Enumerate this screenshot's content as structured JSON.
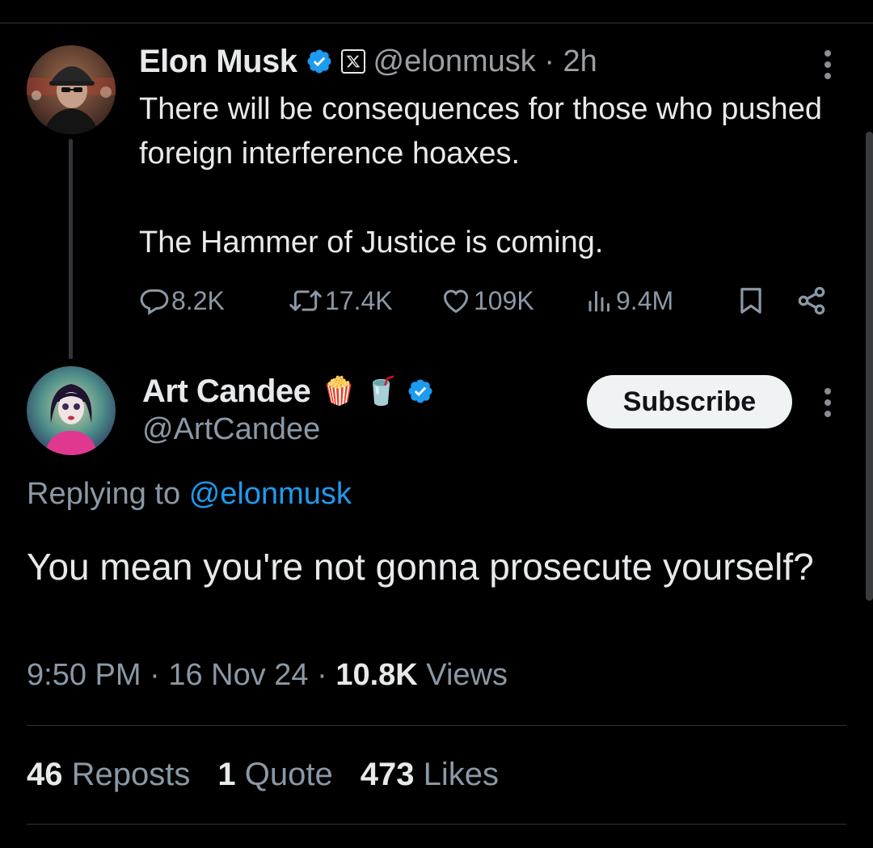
{
  "parent_tweet": {
    "author_name": "Elon Musk",
    "handle": "@elonmusk",
    "separator": "·",
    "time": "2h",
    "text_line1": "There will be consequences for those who pushed foreign interference hoaxes.",
    "text_line2": "The Hammer of Justice is coming.",
    "replies": "8.2K",
    "reposts": "17.4K",
    "likes": "109K",
    "views": "9.4M",
    "icons": [
      "verified-badge-icon",
      "x-affiliate-icon",
      "reply-icon",
      "repost-icon",
      "like-icon",
      "views-icon",
      "bookmark-icon",
      "share-icon",
      "more-icon"
    ]
  },
  "reply_tweet": {
    "author_name": "Art Candee",
    "name_emojis": [
      "🍿",
      "🥤"
    ],
    "handle": "@ArtCandee",
    "subscribe_label": "Subscribe",
    "replying_prefix": "Replying to",
    "replying_to": "@elonmusk",
    "text": "You mean you're not gonna prosecute yourself?",
    "time": "9:50 PM",
    "date": "16 Nov 24",
    "views_count": "10.8K",
    "views_label": "Views",
    "reposts_count": "46",
    "reposts_label": "Reposts",
    "quotes_count": "1",
    "quotes_label": "Quote",
    "likes_count": "473",
    "likes_label": "Likes"
  },
  "colors": {
    "background": "#000000",
    "text": "#e7e9ea",
    "secondary": "#8b98a5",
    "accent": "#1d9bf0",
    "divider": "#2f3336"
  }
}
